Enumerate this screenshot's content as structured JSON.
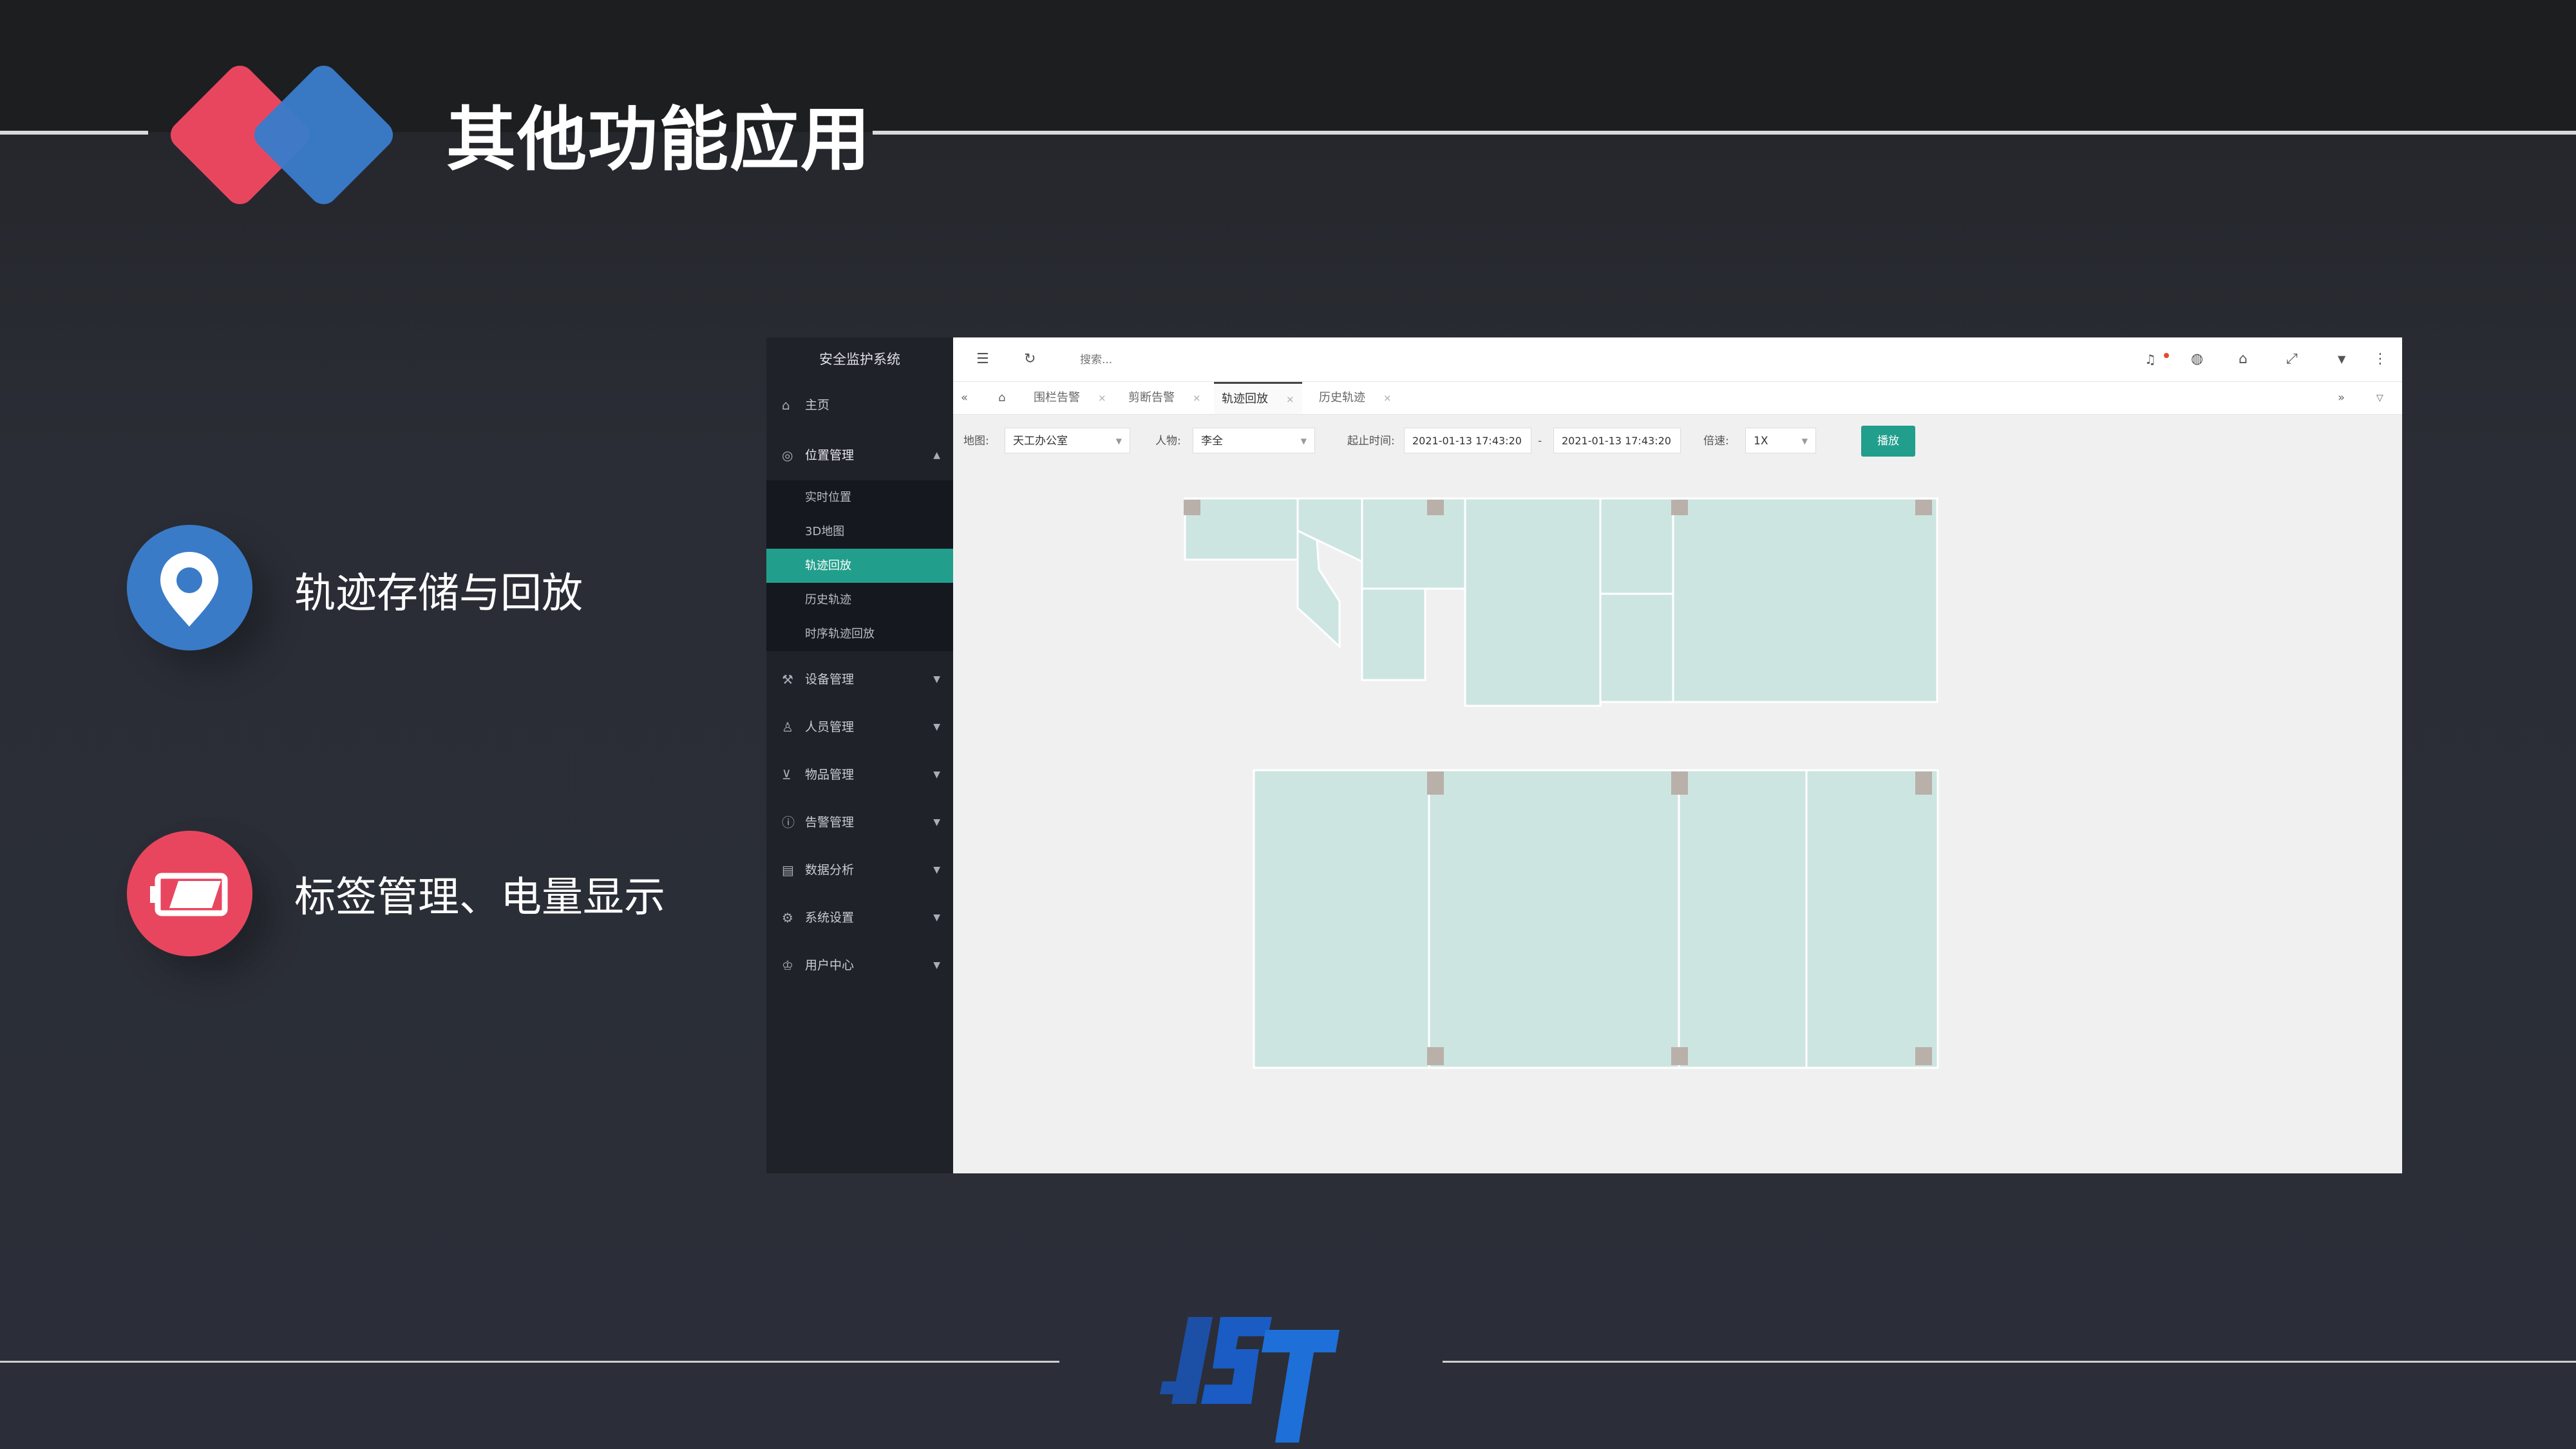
{
  "slide": {
    "title": "其他功能应用",
    "features": [
      {
        "text": "轨迹存储与回放",
        "icon": "location-pin-icon",
        "color": "#3a7bc8"
      },
      {
        "text": "标签管理、电量显示",
        "icon": "battery-icon",
        "color": "#e8465f"
      }
    ],
    "accent_colors": {
      "red": "#e8465f",
      "blue": "#3a7bc8"
    },
    "logo": "IST"
  },
  "app": {
    "system_title": "安全监护系统",
    "sidebar": {
      "home": "主页",
      "location_group": "位置管理",
      "location_sub": [
        "实时位置",
        "3D地图",
        "轨迹回放",
        "历史轨迹",
        "时序轨迹回放"
      ],
      "active_sub": "轨迹回放",
      "groups": [
        "设备管理",
        "人员管理",
        "物品管理",
        "告警管理",
        "数据分析",
        "系统设置",
        "用户中心"
      ]
    },
    "topbar": {
      "search_placeholder": "搜索..."
    },
    "tabs": [
      "围栏告警",
      "剪断告警",
      "轨迹回放",
      "历史轨迹"
    ],
    "active_tab": "轨迹回放",
    "filters": {
      "map_label": "地图:",
      "map_value": "天工办公室",
      "person_label": "人物:",
      "person_value": "李全",
      "time_label": "起止时间:",
      "start_time": "2021-01-13 17:43:20",
      "range_sep": "-",
      "end_time": "2021-01-13 17:43:20",
      "speed_label": "倍速:",
      "speed_value": "1X",
      "play_button": "播放"
    },
    "colors": {
      "primary": "#229e8c",
      "sidebar_bg": "#1f2229",
      "room_fill": "#cce5e1"
    }
  }
}
